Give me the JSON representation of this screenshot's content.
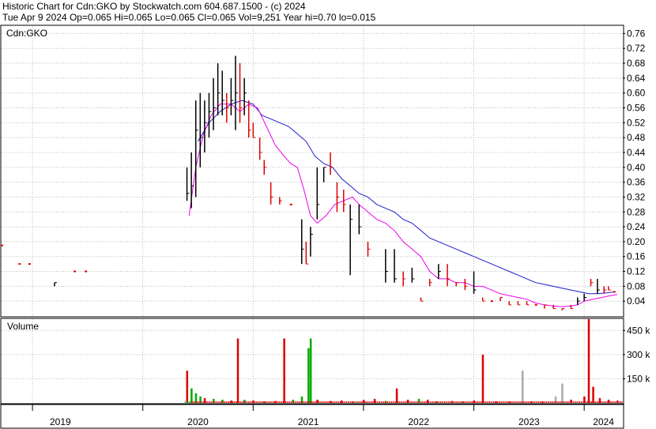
{
  "header": {
    "line1": "Historic Chart for Cdn:GKO by Stockwatch.com 604.687.1500 - (c) 2024",
    "line2": "Tue Apr  9 2024  Op=0.065  Hi=0.065  Lo=0.065  Cl=0.065  Vol=9,251  Year hi=0.70  lo=0.015"
  },
  "chart_data": [
    {
      "type": "line",
      "panel": "price",
      "label": "Cdn:GKO",
      "ylim": [
        0,
        0.78
      ],
      "yticks": [
        "0.76",
        "0.72",
        "0.68",
        "0.64",
        "0.60",
        "0.56",
        "0.52",
        "0.48",
        "0.44",
        "0.40",
        "0.36",
        "0.32",
        "0.28",
        "0.24",
        "0.20",
        "0.16",
        "0.12",
        "0.08",
        "0.04"
      ],
      "grid": true,
      "xlabels": [
        "2019",
        "2020",
        "2021",
        "2022",
        "2023",
        "2024"
      ],
      "x_dividers": [
        2019.0,
        2020.0,
        2021.0,
        2022.0,
        2023.0,
        2024.0
      ],
      "x_range": [
        2018.72,
        2024.35
      ],
      "colors": {
        "ma_short": "#ee00ee",
        "ma_long": "#1a1acc",
        "bar_down": "#dd0000",
        "bar_up": "#000000"
      },
      "price_bars": [
        [
          2018.72,
          0.19,
          0.19,
          0.19,
          "d"
        ],
        [
          2018.88,
          0.14,
          0.14,
          0.14,
          "d"
        ],
        [
          2018.97,
          0.14,
          0.14,
          0.14,
          "d"
        ],
        [
          2019.2,
          0.09,
          0.08,
          0.09,
          "u"
        ],
        [
          2019.38,
          0.12,
          0.12,
          0.12,
          "d"
        ],
        [
          2019.48,
          0.12,
          0.12,
          0.12,
          "d"
        ],
        [
          2020.4,
          0.4,
          0.31,
          0.33,
          "u"
        ],
        [
          2020.44,
          0.44,
          0.29,
          0.35,
          "u"
        ],
        [
          2020.48,
          0.58,
          0.32,
          0.5,
          "u"
        ],
        [
          2020.52,
          0.6,
          0.4,
          0.48,
          "u"
        ],
        [
          2020.56,
          0.58,
          0.44,
          0.52,
          "u"
        ],
        [
          2020.6,
          0.6,
          0.48,
          0.55,
          "u"
        ],
        [
          2020.64,
          0.64,
          0.5,
          0.56,
          "u"
        ],
        [
          2020.68,
          0.68,
          0.54,
          0.6,
          "u"
        ],
        [
          2020.72,
          0.66,
          0.54,
          0.58,
          "u"
        ],
        [
          2020.76,
          0.6,
          0.52,
          0.56,
          "d"
        ],
        [
          2020.8,
          0.64,
          0.54,
          0.58,
          "u"
        ],
        [
          2020.84,
          0.7,
          0.5,
          0.6,
          "u"
        ],
        [
          2020.88,
          0.68,
          0.52,
          0.56,
          "d"
        ],
        [
          2020.92,
          0.64,
          0.54,
          0.6,
          "u"
        ],
        [
          2020.96,
          0.58,
          0.48,
          0.5,
          "d"
        ],
        [
          2021.0,
          0.52,
          0.48,
          0.48,
          "d"
        ],
        [
          2021.06,
          0.48,
          0.42,
          0.44,
          "d"
        ],
        [
          2021.1,
          0.42,
          0.38,
          0.4,
          "d"
        ],
        [
          2021.16,
          0.36,
          0.3,
          0.32,
          "d"
        ],
        [
          2021.24,
          0.32,
          0.3,
          0.31,
          "d"
        ],
        [
          2021.34,
          0.3,
          0.3,
          0.3,
          "d"
        ],
        [
          2021.44,
          0.26,
          0.14,
          0.18,
          "u"
        ],
        [
          2021.48,
          0.2,
          0.14,
          0.14,
          "d"
        ],
        [
          2021.52,
          0.24,
          0.16,
          0.22,
          "u"
        ],
        [
          2021.58,
          0.4,
          0.26,
          0.3,
          "u"
        ],
        [
          2021.64,
          0.4,
          0.36,
          0.4,
          "u"
        ],
        [
          2021.7,
          0.44,
          0.38,
          0.4,
          "d"
        ],
        [
          2021.76,
          0.36,
          0.28,
          0.32,
          "d"
        ],
        [
          2021.82,
          0.34,
          0.28,
          0.3,
          "d"
        ],
        [
          2021.88,
          0.3,
          0.11,
          0.26,
          "u"
        ],
        [
          2021.96,
          0.3,
          0.22,
          0.24,
          "u"
        ],
        [
          2022.04,
          0.2,
          0.16,
          0.18,
          "d"
        ],
        [
          2022.2,
          0.18,
          0.09,
          0.12,
          "u"
        ],
        [
          2022.28,
          0.18,
          0.09,
          0.1,
          "u"
        ],
        [
          2022.36,
          0.12,
          0.08,
          0.1,
          "d"
        ],
        [
          2022.44,
          0.13,
          0.09,
          0.1,
          "u"
        ],
        [
          2022.52,
          0.05,
          0.04,
          0.04,
          "d"
        ],
        [
          2022.6,
          0.1,
          0.08,
          0.09,
          "d"
        ],
        [
          2022.68,
          0.14,
          0.1,
          0.12,
          "u"
        ],
        [
          2022.76,
          0.14,
          0.08,
          0.1,
          "d"
        ],
        [
          2022.84,
          0.09,
          0.08,
          0.09,
          "d"
        ],
        [
          2022.92,
          0.1,
          0.07,
          0.08,
          "d"
        ],
        [
          2023.0,
          0.12,
          0.06,
          0.07,
          "u"
        ],
        [
          2023.08,
          0.05,
          0.04,
          0.04,
          "d"
        ],
        [
          2023.16,
          0.04,
          0.04,
          0.04,
          "d"
        ],
        [
          2023.24,
          0.05,
          0.04,
          0.05,
          "d"
        ],
        [
          2023.32,
          0.04,
          0.03,
          0.03,
          "d"
        ],
        [
          2023.4,
          0.04,
          0.03,
          0.03,
          "d"
        ],
        [
          2023.48,
          0.04,
          0.03,
          0.03,
          "d"
        ],
        [
          2023.56,
          0.03,
          0.03,
          0.03,
          "d"
        ],
        [
          2023.64,
          0.03,
          0.02,
          0.03,
          "d"
        ],
        [
          2023.72,
          0.03,
          0.02,
          0.02,
          "d"
        ],
        [
          2023.8,
          0.02,
          0.015,
          0.02,
          "d"
        ],
        [
          2023.88,
          0.03,
          0.02,
          0.02,
          "d"
        ],
        [
          2023.94,
          0.05,
          0.03,
          0.04,
          "u"
        ],
        [
          2024.0,
          0.06,
          0.04,
          0.05,
          "u"
        ],
        [
          2024.06,
          0.1,
          0.08,
          0.09,
          "d"
        ],
        [
          2024.12,
          0.1,
          0.06,
          0.07,
          "u"
        ],
        [
          2024.18,
          0.08,
          0.06,
          0.07,
          "d"
        ],
        [
          2024.22,
          0.08,
          0.07,
          0.07,
          "d"
        ],
        [
          2024.27,
          0.065,
          0.065,
          0.065,
          "d"
        ]
      ],
      "ma_short": [
        [
          2020.42,
          0.27
        ],
        [
          2020.48,
          0.4
        ],
        [
          2020.55,
          0.49
        ],
        [
          2020.62,
          0.54
        ],
        [
          2020.7,
          0.57
        ],
        [
          2020.8,
          0.57
        ],
        [
          2020.88,
          0.55
        ],
        [
          2020.96,
          0.57
        ],
        [
          2021.04,
          0.56
        ],
        [
          2021.12,
          0.51
        ],
        [
          2021.2,
          0.46
        ],
        [
          2021.28,
          0.43
        ],
        [
          2021.34,
          0.41
        ],
        [
          2021.4,
          0.4
        ],
        [
          2021.46,
          0.34
        ],
        [
          2021.52,
          0.27
        ],
        [
          2021.58,
          0.25
        ],
        [
          2021.66,
          0.27
        ],
        [
          2021.74,
          0.3
        ],
        [
          2021.82,
          0.31
        ],
        [
          2021.9,
          0.32
        ],
        [
          2021.96,
          0.3
        ],
        [
          2022.04,
          0.28
        ],
        [
          2022.12,
          0.26
        ],
        [
          2022.2,
          0.25
        ],
        [
          2022.28,
          0.23
        ],
        [
          2022.36,
          0.2
        ],
        [
          2022.44,
          0.18
        ],
        [
          2022.52,
          0.16
        ],
        [
          2022.6,
          0.12
        ],
        [
          2022.68,
          0.1
        ],
        [
          2022.76,
          0.1
        ],
        [
          2022.84,
          0.09
        ],
        [
          2022.92,
          0.09
        ],
        [
          2023.0,
          0.08
        ],
        [
          2023.08,
          0.08
        ],
        [
          2023.16,
          0.07
        ],
        [
          2023.24,
          0.06
        ],
        [
          2023.32,
          0.055
        ],
        [
          2023.4,
          0.05
        ],
        [
          2023.48,
          0.045
        ],
        [
          2023.56,
          0.035
        ],
        [
          2023.64,
          0.03
        ],
        [
          2023.72,
          0.027
        ],
        [
          2023.8,
          0.025
        ],
        [
          2023.88,
          0.027
        ],
        [
          2023.94,
          0.03
        ],
        [
          2024.0,
          0.04
        ],
        [
          2024.08,
          0.045
        ],
        [
          2024.16,
          0.05
        ],
        [
          2024.24,
          0.055
        ],
        [
          2024.3,
          0.058
        ]
      ],
      "ma_long": [
        [
          2020.5,
          0.47
        ],
        [
          2020.6,
          0.52
        ],
        [
          2020.7,
          0.55
        ],
        [
          2020.8,
          0.57
        ],
        [
          2020.9,
          0.58
        ],
        [
          2021.0,
          0.57
        ],
        [
          2021.08,
          0.54
        ],
        [
          2021.16,
          0.53
        ],
        [
          2021.24,
          0.52
        ],
        [
          2021.32,
          0.51
        ],
        [
          2021.4,
          0.49
        ],
        [
          2021.48,
          0.47
        ],
        [
          2021.56,
          0.43
        ],
        [
          2021.64,
          0.41
        ],
        [
          2021.72,
          0.4
        ],
        [
          2021.8,
          0.37
        ],
        [
          2021.88,
          0.35
        ],
        [
          2021.96,
          0.33
        ],
        [
          2022.04,
          0.32
        ],
        [
          2022.12,
          0.3
        ],
        [
          2022.2,
          0.29
        ],
        [
          2022.28,
          0.28
        ],
        [
          2022.36,
          0.26
        ],
        [
          2022.44,
          0.25
        ],
        [
          2022.52,
          0.23
        ],
        [
          2022.6,
          0.21
        ],
        [
          2022.68,
          0.2
        ],
        [
          2022.76,
          0.19
        ],
        [
          2022.84,
          0.18
        ],
        [
          2022.92,
          0.17
        ],
        [
          2023.0,
          0.16
        ],
        [
          2023.08,
          0.15
        ],
        [
          2023.16,
          0.14
        ],
        [
          2023.24,
          0.13
        ],
        [
          2023.32,
          0.12
        ],
        [
          2023.4,
          0.11
        ],
        [
          2023.48,
          0.1
        ],
        [
          2023.56,
          0.09
        ],
        [
          2023.64,
          0.085
        ],
        [
          2023.72,
          0.08
        ],
        [
          2023.8,
          0.075
        ],
        [
          2023.88,
          0.07
        ],
        [
          2023.96,
          0.065
        ],
        [
          2024.04,
          0.06
        ],
        [
          2024.12,
          0.06
        ],
        [
          2024.2,
          0.062
        ],
        [
          2024.28,
          0.065
        ]
      ]
    },
    {
      "type": "bar",
      "panel": "volume",
      "label": "Volume",
      "ylim": [
        0,
        520
      ],
      "yticks": [
        "450 k",
        "300 k",
        "150 k"
      ],
      "ytick_values": [
        450,
        300,
        150
      ],
      "colors": {
        "up": "#00aa00",
        "down": "#dd0000",
        "flat": "#aaaaaa"
      },
      "bars": [
        [
          2020.4,
          200,
          "d"
        ],
        [
          2020.44,
          90,
          "g"
        ],
        [
          2020.48,
          60,
          "g"
        ],
        [
          2020.52,
          40,
          "g"
        ],
        [
          2020.56,
          30,
          "d"
        ],
        [
          2020.64,
          25,
          "g"
        ],
        [
          2020.72,
          20,
          "g"
        ],
        [
          2020.8,
          15,
          "d"
        ],
        [
          2020.86,
          400,
          "d"
        ],
        [
          2020.92,
          20,
          "g"
        ],
        [
          2021.0,
          15,
          "d"
        ],
        [
          2021.1,
          10,
          "g"
        ],
        [
          2021.2,
          12,
          "d"
        ],
        [
          2021.28,
          400,
          "d"
        ],
        [
          2021.36,
          20,
          "g"
        ],
        [
          2021.44,
          40,
          "g"
        ],
        [
          2021.5,
          340,
          "g"
        ],
        [
          2021.52,
          400,
          "g"
        ],
        [
          2021.58,
          20,
          "d"
        ],
        [
          2021.7,
          12,
          "d"
        ],
        [
          2021.8,
          15,
          "d"
        ],
        [
          2021.9,
          10,
          "g"
        ],
        [
          2022.0,
          20,
          "d"
        ],
        [
          2022.1,
          25,
          "d"
        ],
        [
          2022.2,
          12,
          "g"
        ],
        [
          2022.3,
          90,
          "d"
        ],
        [
          2022.4,
          20,
          "d"
        ],
        [
          2022.5,
          25,
          "g"
        ],
        [
          2022.58,
          20,
          "d"
        ],
        [
          2022.66,
          10,
          "g"
        ],
        [
          2022.8,
          12,
          "d"
        ],
        [
          2022.9,
          10,
          "g"
        ],
        [
          2023.0,
          15,
          "d"
        ],
        [
          2023.08,
          300,
          "d"
        ],
        [
          2023.2,
          10,
          "d"
        ],
        [
          2023.32,
          8,
          "d"
        ],
        [
          2023.44,
          200,
          "f"
        ],
        [
          2023.52,
          10,
          "d"
        ],
        [
          2023.62,
          8,
          "d"
        ],
        [
          2023.74,
          40,
          "f"
        ],
        [
          2023.8,
          120,
          "f"
        ],
        [
          2023.88,
          20,
          "d"
        ],
        [
          2024.0,
          40,
          "d"
        ],
        [
          2024.04,
          580,
          "d"
        ],
        [
          2024.08,
          100,
          "d"
        ],
        [
          2024.14,
          30,
          "d"
        ],
        [
          2024.22,
          20,
          "d"
        ],
        [
          2024.3,
          15,
          "d"
        ]
      ]
    }
  ]
}
